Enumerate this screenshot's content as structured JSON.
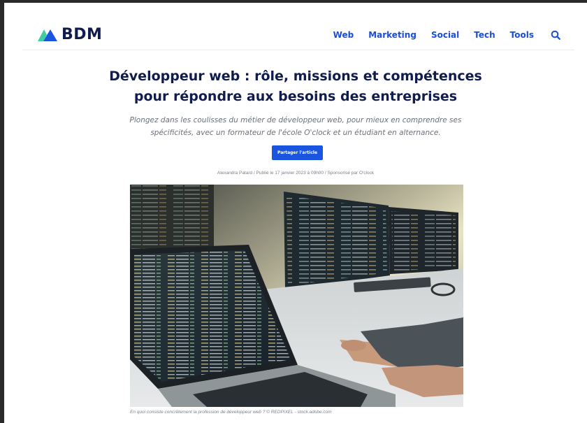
{
  "header": {
    "logo_text": "BDM",
    "nav": [
      {
        "label": "Web"
      },
      {
        "label": "Marketing"
      },
      {
        "label": "Social"
      },
      {
        "label": "Tech"
      },
      {
        "label": "Tools"
      }
    ],
    "search_icon": "search-icon"
  },
  "article": {
    "title_line1": "Développeur web : rôle, missions et compétences",
    "title_line2": "pour répondre aux besoins des entreprises",
    "subtitle_line1": "Plongez dans les coulisses du métier de développeur web, pour mieux en comprendre ses",
    "subtitle_line2": "spécificités, avec un formateur de l'école O'clock et un étudiant en alternance.",
    "share_label": "Partager l'article",
    "meta": "Alexandra Patard / Publié le 17 janvier 2023 à 09h00 / Sponsorisé par O'clock",
    "image_caption": "En quoi consiste concrètement la profession de développeur web ? © REDPIXEL - stock.adobe.com"
  },
  "colors": {
    "brand_navy": "#0f1c4d",
    "accent_blue": "#1a55e0",
    "logo_green": "#3ecfa0"
  }
}
